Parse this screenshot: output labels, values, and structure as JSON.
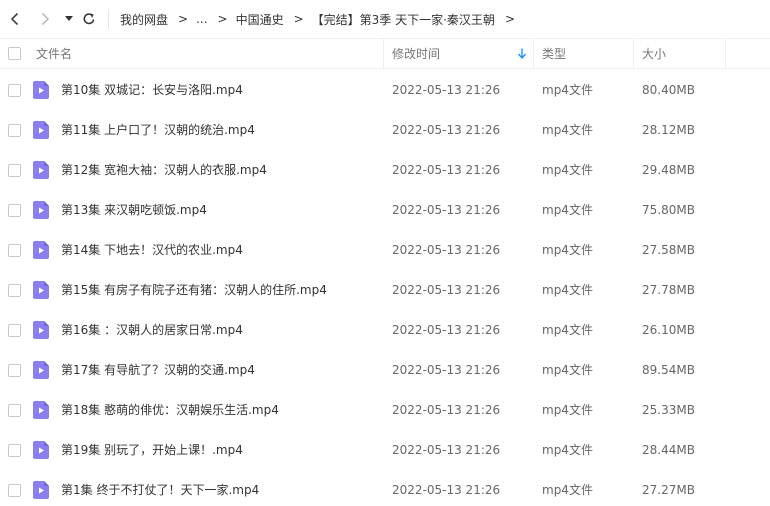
{
  "nav": {
    "back_icon": "chevron-left",
    "forward_icon": "chevron-right",
    "history_icon": "caret-down",
    "refresh_icon": "refresh"
  },
  "breadcrumb": {
    "items": [
      "我的网盘",
      "...",
      "中国通史",
      "【完结】第3季 天下一家·秦汉王朝"
    ],
    "arrow": ">"
  },
  "columns": {
    "name": "文件名",
    "modified": "修改时间",
    "type": "类型",
    "size": "大小",
    "sort_icon": "arrow-down",
    "sort_color": "#1e90ff"
  },
  "colors": {
    "file_icon": "#8b7ff0",
    "file_icon_dark": "#6e61e6"
  },
  "files": [
    {
      "name": "第10集 双城记：长安与洛阳.mp4",
      "modified": "2022-05-13 21:26",
      "type": "mp4文件",
      "size": "80.40MB"
    },
    {
      "name": "第11集 上户口了！汉朝的统治.mp4",
      "modified": "2022-05-13 21:26",
      "type": "mp4文件",
      "size": "28.12MB"
    },
    {
      "name": "第12集 宽袍大袖：汉朝人的衣服.mp4",
      "modified": "2022-05-13 21:26",
      "type": "mp4文件",
      "size": "29.48MB"
    },
    {
      "name": "第13集 来汉朝吃顿饭.mp4",
      "modified": "2022-05-13 21:26",
      "type": "mp4文件",
      "size": "75.80MB"
    },
    {
      "name": "第14集 下地去！汉代的农业.mp4",
      "modified": "2022-05-13 21:26",
      "type": "mp4文件",
      "size": "27.58MB"
    },
    {
      "name": "第15集 有房子有院子还有猪：汉朝人的住所.mp4",
      "modified": "2022-05-13 21:26",
      "type": "mp4文件",
      "size": "27.78MB"
    },
    {
      "name": "第16集 ：汉朝人的居家日常.mp4",
      "modified": "2022-05-13 21:26",
      "type": "mp4文件",
      "size": "26.10MB"
    },
    {
      "name": "第17集 有导航了？汉朝的交通.mp4",
      "modified": "2022-05-13 21:26",
      "type": "mp4文件",
      "size": "89.54MB"
    },
    {
      "name": "第18集 憨萌的俳优：汉朝娱乐生活.mp4",
      "modified": "2022-05-13 21:26",
      "type": "mp4文件",
      "size": "25.33MB"
    },
    {
      "name": "第19集 别玩了，开始上课！.mp4",
      "modified": "2022-05-13 21:26",
      "type": "mp4文件",
      "size": "28.44MB"
    },
    {
      "name": "第1集 终于不打仗了！天下一家.mp4",
      "modified": "2022-05-13 21:26",
      "type": "mp4文件",
      "size": "27.27MB"
    }
  ]
}
